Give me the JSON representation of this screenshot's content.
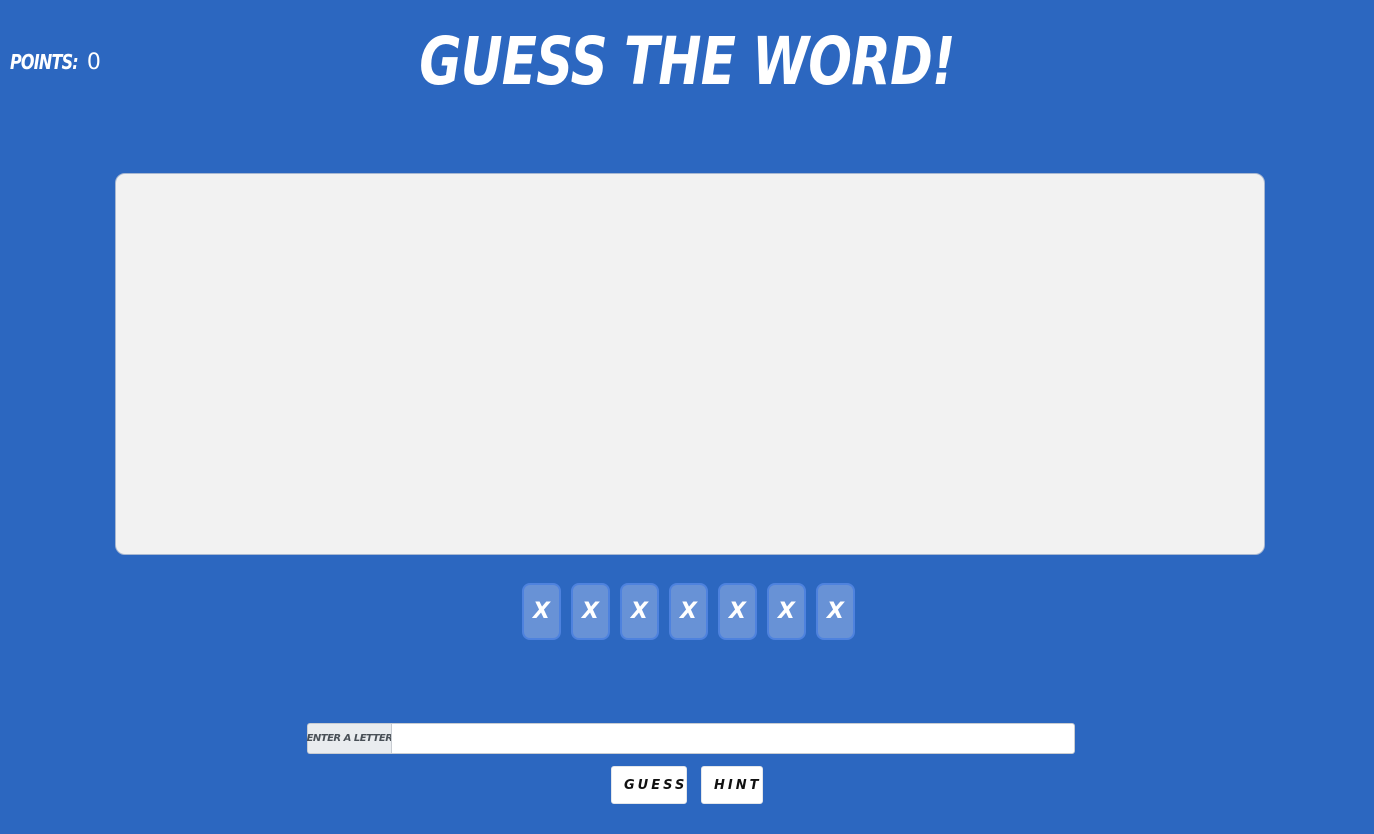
{
  "header": {
    "points_label": "POINTS:",
    "points_value": "0",
    "title": "GUESS THE WORD!"
  },
  "letter_slots": [
    "X",
    "X",
    "X",
    "X",
    "X",
    "X",
    "X"
  ],
  "input": {
    "addon_label": "ENTER A LETTER",
    "value": "",
    "placeholder": ""
  },
  "buttons": {
    "guess_label": "GUESS",
    "hint_label": "HINT"
  },
  "colors": {
    "background": "#2c67c0",
    "panel": "#f2f2f2",
    "slot": "#6892d6",
    "slot_border": "#4e82de",
    "text_light": "#ffffff"
  }
}
